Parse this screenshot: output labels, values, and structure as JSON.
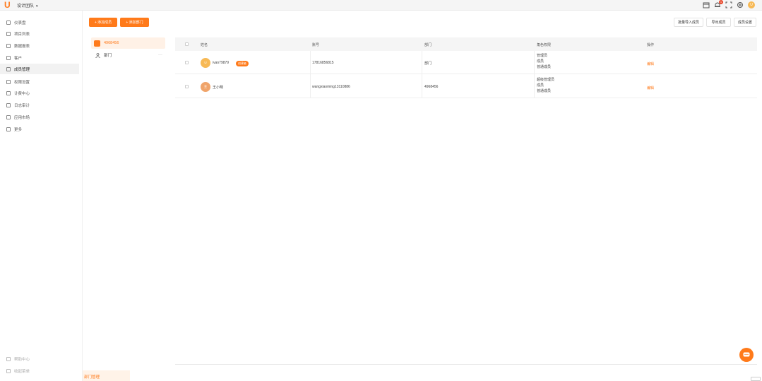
{
  "colors": {
    "accent": "#ff7a1a",
    "avatar1": "#f7b955",
    "avatar2": "#f0a46a"
  },
  "topbar": {
    "org_name": "设计团队",
    "caret": "▾",
    "notif_count": "1",
    "user_initial": "U"
  },
  "sidebar": {
    "items": [
      {
        "label": "仪表盘",
        "icon": "home-icon"
      },
      {
        "label": "项目列表",
        "icon": "list-icon"
      },
      {
        "label": "数据报表",
        "icon": "report-icon"
      },
      {
        "label": "客户",
        "icon": "user-icon"
      },
      {
        "label": "成员管理",
        "icon": "members-icon"
      },
      {
        "label": "权限设置",
        "icon": "lock-icon"
      },
      {
        "label": "计费中心",
        "icon": "billing-icon"
      },
      {
        "label": "日志审计",
        "icon": "log-icon"
      },
      {
        "label": "应用市场",
        "icon": "apps-icon"
      },
      {
        "label": "更多",
        "icon": "more-icon"
      }
    ],
    "bottom": [
      {
        "label": "帮助中心"
      },
      {
        "label": "收起菜单"
      }
    ]
  },
  "actions": {
    "add_member": "+ 添加成员",
    "add_dept": "+ 添加部门",
    "batch_import": "批量导入成员",
    "export": "导出成员",
    "settings": "成员设置"
  },
  "tree": {
    "root": "4968456",
    "child": "部门",
    "more": "···"
  },
  "table": {
    "headers": [
      "姓名",
      "账号",
      "部门",
      "角色权限",
      "操作"
    ],
    "rows": [
      {
        "avatar": "U",
        "name": "ivan79879",
        "tag": "创建者",
        "account": "17816856815",
        "dept": "部门",
        "roles": [
          "管理员",
          "成员",
          "普通成员"
        ],
        "op": "编辑"
      },
      {
        "avatar": "王",
        "name": "王小明",
        "tag": "",
        "account": "wangxiaoming13110886",
        "dept": "4968456",
        "roles": [
          "超级管理员",
          "成员",
          "普通成员"
        ],
        "op": "编辑"
      }
    ]
  },
  "bottom_tag": "部门管理"
}
